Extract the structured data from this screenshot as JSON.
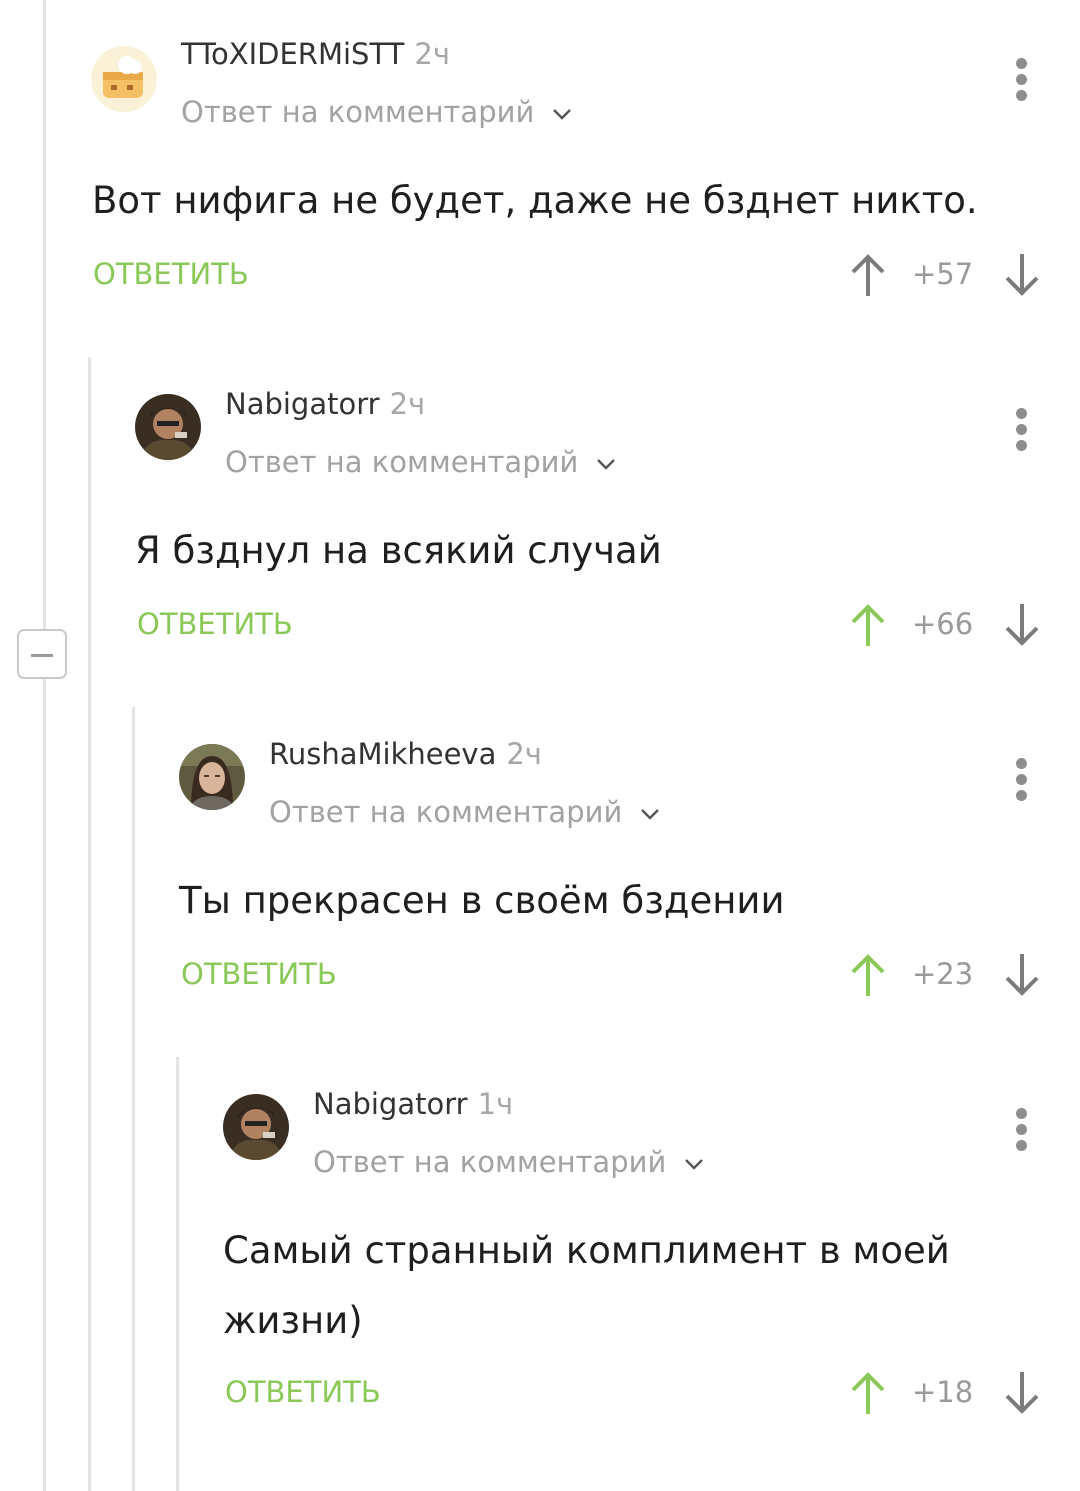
{
  "comments": [
    {
      "author": "TToXIDERMiSTT",
      "time": "2ч",
      "reply_to": "Ответ на комментарий",
      "text": "Вот нифига не будет, даже не бзднет никто.",
      "reply_label": "ОТВЕТИТЬ",
      "score": "+57",
      "upvoted": false
    },
    {
      "author": "Nabigatorr",
      "time": "2ч",
      "reply_to": "Ответ на комментарий",
      "text": "Я бзднул на всякий случай",
      "reply_label": "ОТВЕТИТЬ",
      "score": "+66",
      "upvoted": true
    },
    {
      "author": "RushaMikheeva",
      "time": "2ч",
      "reply_to": "Ответ на комментарий",
      "text": "Ты прекрасен в своём бздении",
      "reply_label": "ОТВЕТИТЬ",
      "score": "+23",
      "upvoted": true
    },
    {
      "author": "Nabigatorr",
      "time": "1ч",
      "reply_to": "Ответ на комментарий",
      "text": "Самый странный комплимент в моей жизни)",
      "reply_label": "ОТВЕТИТЬ",
      "score": "+18",
      "upvoted": true
    }
  ],
  "icons": {
    "upvote": "up-arrow-icon",
    "downvote": "down-arrow-icon",
    "menu": "more-vertical-icon",
    "expand": "chevron-down-icon",
    "collapse": "minus-icon"
  },
  "colors": {
    "accent_green": "#8ac858",
    "muted_text": "#a2a2a2",
    "thread_line": "#e4e4e4"
  }
}
